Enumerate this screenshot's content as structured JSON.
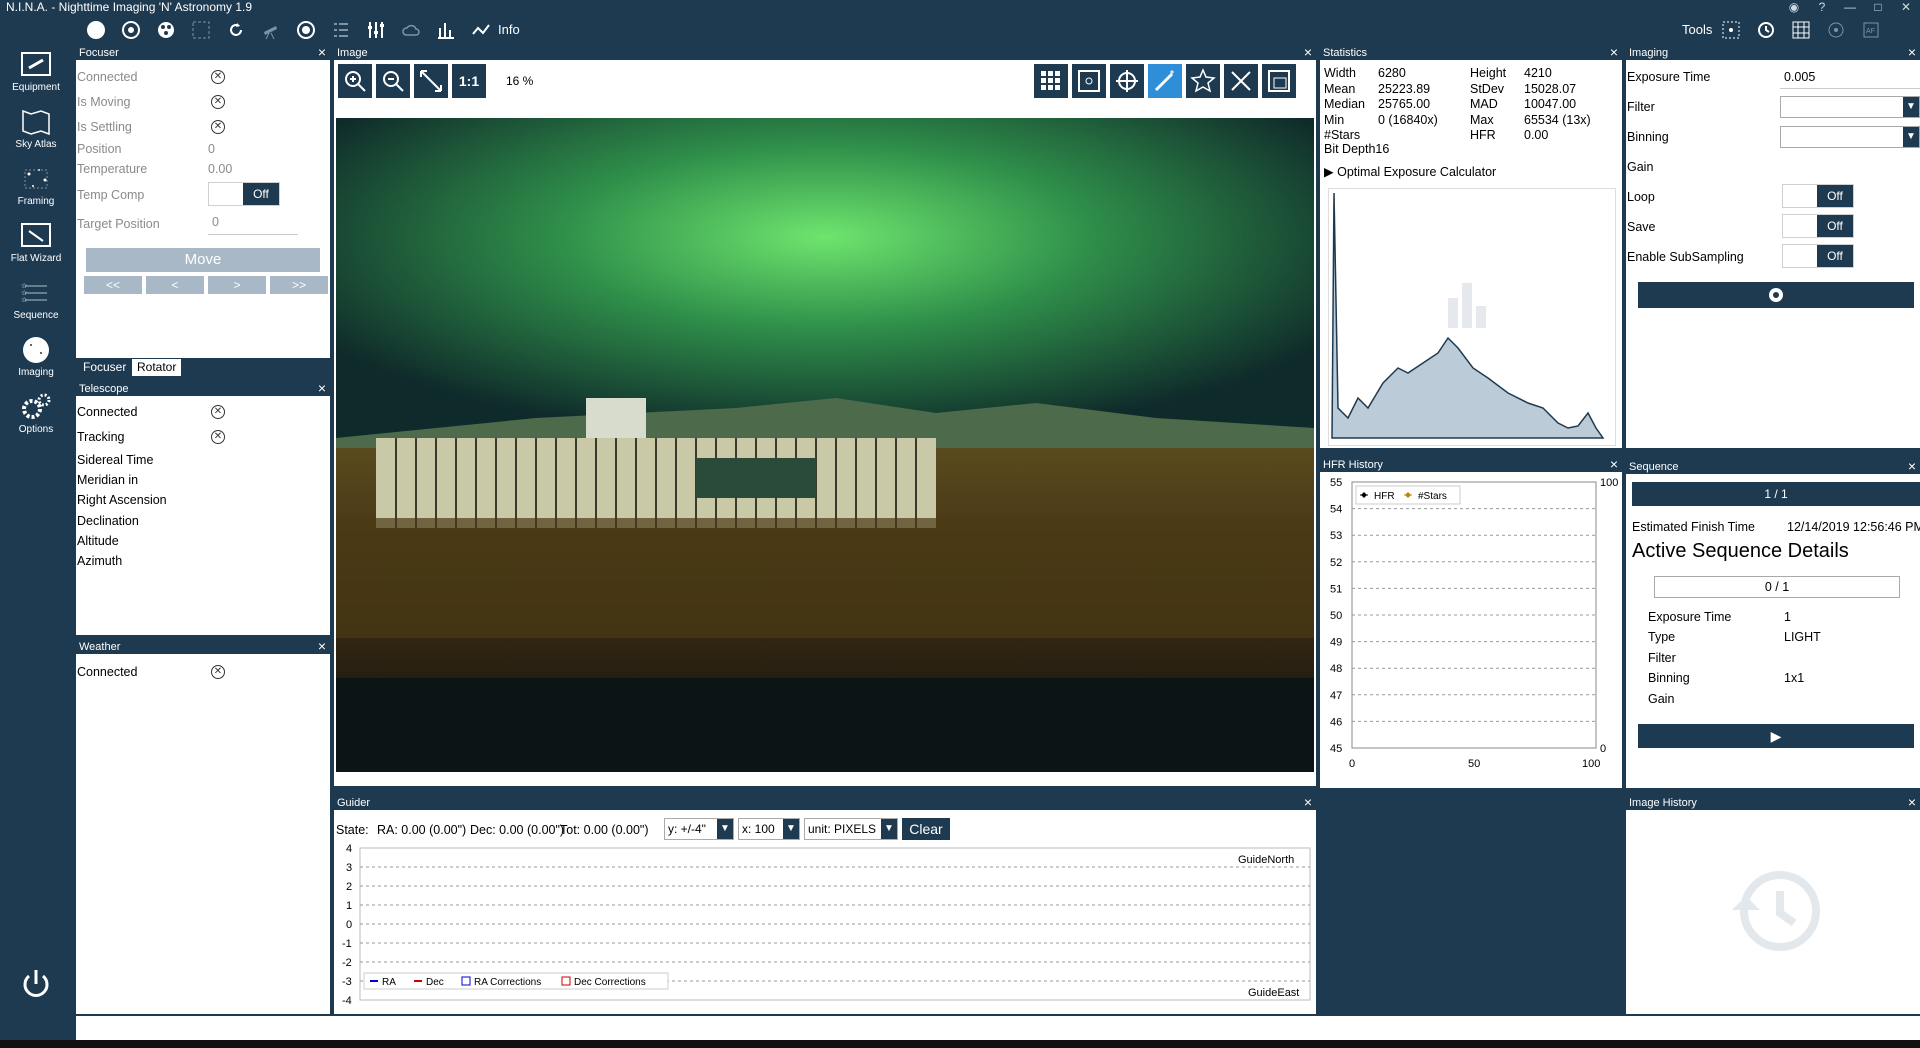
{
  "app": {
    "title": "N.I.N.A. - Nighttime Imaging 'N' Astronomy 1.9",
    "info_label": "Info",
    "tools_label": "Tools"
  },
  "nav": {
    "items": [
      {
        "label": "Equipment"
      },
      {
        "label": "Sky Atlas"
      },
      {
        "label": "Framing"
      },
      {
        "label": "Flat Wizard"
      },
      {
        "label": "Sequence"
      },
      {
        "label": "Imaging"
      },
      {
        "label": "Options"
      }
    ]
  },
  "focuser": {
    "title": "Focuser",
    "connected": "Connected",
    "is_moving": "Is Moving",
    "is_settling": "Is Settling",
    "position_label": "Position",
    "position_value": "0",
    "temperature_label": "Temperature",
    "temperature_value": "0.00",
    "temp_comp_label": "Temp Comp",
    "temp_comp_state": "Off",
    "target_position_label": "Target Position",
    "target_position_value": "0",
    "move_label": "Move",
    "btn_ll": "<<",
    "btn_l": "<",
    "btn_r": ">",
    "btn_rr": ">>"
  },
  "tabs": {
    "focuser": "Focuser",
    "rotator": "Rotator"
  },
  "telescope": {
    "title": "Telescope",
    "connected": "Connected",
    "tracking": "Tracking",
    "sidereal_time": "Sidereal Time",
    "meridian_in": "Meridian in",
    "right_ascension": "Right Ascension",
    "declination": "Declination",
    "altitude": "Altitude",
    "azimuth": "Azimuth"
  },
  "weather": {
    "title": "Weather",
    "connected": "Connected"
  },
  "image": {
    "title": "Image",
    "one_to_one": "1:1",
    "zoom": "16 %"
  },
  "statistics": {
    "title": "Statistics",
    "rows": [
      {
        "l1": "Width",
        "v1": "6280",
        "l2": "Height",
        "v2": "4210"
      },
      {
        "l1": "Mean",
        "v1": "25223.89",
        "l2": "StDev",
        "v2": "15028.07"
      },
      {
        "l1": "Median",
        "v1": "25765.00",
        "l2": "MAD",
        "v2": "10047.00"
      },
      {
        "l1": "Min",
        "v1": "0 (16840x)",
        "l2": "Max",
        "v2": "65534 (13x)"
      },
      {
        "l1": "#Stars",
        "v1": "",
        "l2": "HFR",
        "v2": "0.00"
      }
    ],
    "bit_depth_label": "Bit Depth",
    "bit_depth_value": "16",
    "optimal_calc": "Optimal Exposure Calculator"
  },
  "imaging": {
    "title": "Imaging",
    "exposure_label": "Exposure Time",
    "exposure_value": "0.005",
    "filter_label": "Filter",
    "binning_label": "Binning",
    "gain_label": "Gain",
    "loop_label": "Loop",
    "loop_state": "Off",
    "save_label": "Save",
    "save_state": "Off",
    "subsampling_label": "Enable SubSampling",
    "subsampling_state": "Off"
  },
  "hfr_history": {
    "title": "HFR History",
    "legend_hfr": "HFR",
    "legend_stars": "#Stars",
    "left_ticks": [
      "55",
      "54",
      "53",
      "52",
      "51",
      "50",
      "49",
      "48",
      "47",
      "46",
      "45"
    ],
    "right_top": "100",
    "right_bottom": "0",
    "x_ticks": [
      "0",
      "50",
      "100"
    ]
  },
  "sequence": {
    "title": "Sequence",
    "progress": "1 / 1",
    "finish_label": "Estimated Finish Time",
    "finish_value": "12/14/2019 12:56:46 PM",
    "details_title": "Active Sequence Details",
    "count": "0 / 1",
    "exposure_label": "Exposure Time",
    "exposure_value": "1",
    "type_label": "Type",
    "type_value": "LIGHT",
    "filter_label": "Filter",
    "binning_label": "Binning",
    "binning_value": "1x1",
    "gain_label": "Gain"
  },
  "guider": {
    "title": "Guider",
    "state": "State:",
    "ra": "RA: 0.00 (0.00\")",
    "dec": "Dec: 0.00 (0.00\")",
    "tot": "Tot: 0.00 (0.00\")",
    "y_select": "y: +/-4\"",
    "x_select": "x: 100",
    "unit_select": "unit: PIXELS",
    "clear": "Clear",
    "y_ticks": [
      "4",
      "3",
      "2",
      "1",
      "0",
      "-1",
      "-2",
      "-3",
      "-4"
    ],
    "north": "GuideNorth",
    "east": "GuideEast",
    "legend": [
      "RA",
      "Dec",
      "RA Corrections",
      "Dec Corrections"
    ]
  },
  "image_history": {
    "title": "Image History"
  },
  "colors": {
    "chrome": "#1e3a50",
    "accent": "#2e8fd8"
  }
}
